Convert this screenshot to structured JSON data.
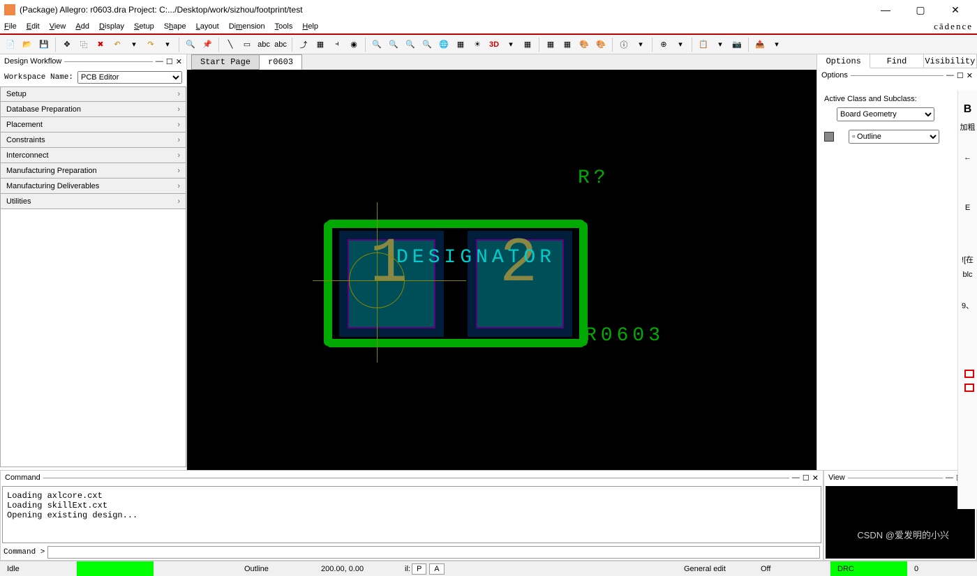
{
  "title": "(Package) Allegro: r0603.dra  Project: C:.../Desktop/work/sizhou/footprint/test",
  "menu": [
    "File",
    "Edit",
    "View",
    "Add",
    "Display",
    "Setup",
    "Shape",
    "Layout",
    "Dimension",
    "Tools",
    "Help"
  ],
  "brand": "cādence",
  "workflow": {
    "title": "Design Workflow",
    "ws_label": "Workspace Name:",
    "ws_value": "PCB Editor",
    "items": [
      "Setup",
      "Database Preparation",
      "Placement",
      "Constraints",
      "Interconnect",
      "Manufacturing Preparation",
      "Manufacturing Deliverables",
      "Utilities"
    ]
  },
  "tabs": {
    "start": "Start Page",
    "active": "r0603"
  },
  "canvas": {
    "refdes": "R?",
    "designator": "DESIGNATOR",
    "value": "R0603",
    "pad1": "1",
    "pad2": "2"
  },
  "right": {
    "tabs": [
      "Options",
      "Find",
      "Visibility"
    ],
    "sub": "Options",
    "label": "Active Class and Subclass:",
    "class": "Board Geometry",
    "subclass": "Outline"
  },
  "command": {
    "title": "Command",
    "log": "Loading axlcore.cxt\nLoading skillExt.cxt\nOpening existing design...",
    "prompt": "Command >"
  },
  "view_title": "View",
  "status": {
    "idle": "Idle",
    "outline": "Outline",
    "coords": "200.00, 0.00",
    "il": "il:",
    "p": "P",
    "a": "A",
    "mode": "General edit",
    "off": "Off",
    "drc": "DRC",
    "drc_count": "0"
  },
  "far": {
    "b": "B",
    "bold": "加粗",
    "e": "E",
    "note": "![在",
    "blc": "blc",
    "nine": "9、"
  },
  "watermark": "CSDN @爱发明的小兴"
}
